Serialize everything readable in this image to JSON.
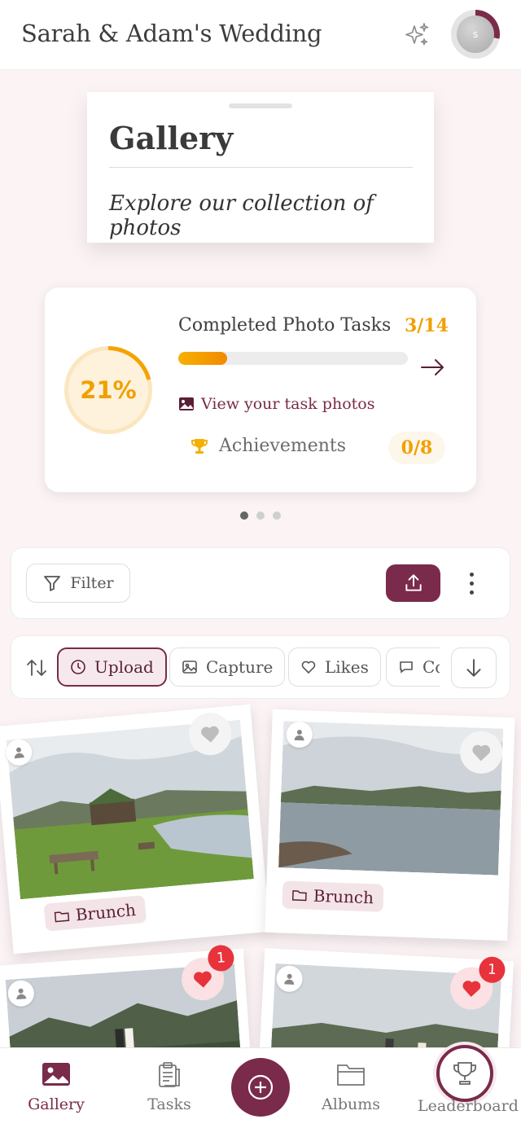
{
  "header": {
    "title": "Sarah & Adam's Wedding",
    "sparkle_icon": "sparkles-icon",
    "avatar_initial": "s"
  },
  "gallery_card": {
    "title": "Gallery",
    "subtitle": "Explore our collection of photos"
  },
  "progress": {
    "percent_label": "21%",
    "percent_value": 0.21,
    "tasks_label": "Completed Photo Tasks",
    "tasks_count": "3/14",
    "tasks_fraction": 0.214,
    "view_photos_link": "View your task photos",
    "achievements_label": "Achievements",
    "achievements_count": "0/8",
    "accent_color": "#f0a000"
  },
  "carousel": {
    "pages": 3,
    "active_page": 1
  },
  "toolbar": {
    "filter_label": "Filter",
    "upload_icon": "upload-icon",
    "more_icon": "more-vertical-icon"
  },
  "sort": {
    "chips": [
      {
        "label": "Upload",
        "icon": "clock-icon",
        "active": true
      },
      {
        "label": "Capture",
        "icon": "image-icon",
        "active": false
      },
      {
        "label": "Likes",
        "icon": "heart-outline-icon",
        "active": false
      },
      {
        "label": "Co",
        "icon": "comment-icon",
        "active": false
      }
    ]
  },
  "photos": [
    {
      "album": "Brunch",
      "liked": false,
      "likes": ""
    },
    {
      "album": "Brunch",
      "liked": false,
      "likes": ""
    },
    {
      "album": "",
      "liked": true,
      "likes": "1"
    },
    {
      "album": "",
      "liked": true,
      "likes": "1"
    }
  ],
  "nav": {
    "gallery": "Gallery",
    "tasks": "Tasks",
    "albums": "Albums",
    "leaderboard": "Leaderboard"
  },
  "theme": {
    "brand": "#7a2a4a",
    "background": "#fbf3f4"
  }
}
